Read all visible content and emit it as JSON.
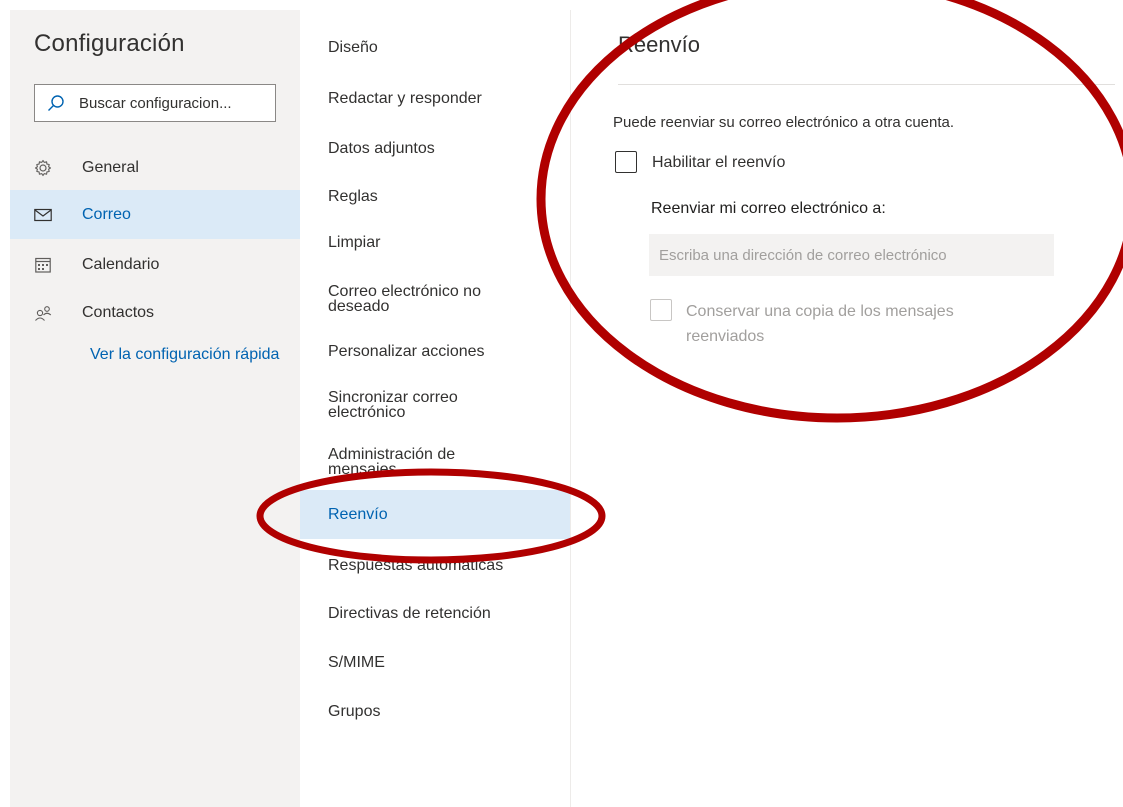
{
  "settings": {
    "title": "Configuración",
    "search_placeholder": "Buscar configuracion..."
  },
  "nav": {
    "items": [
      {
        "label": "General",
        "icon": "gear-icon",
        "selected": false
      },
      {
        "label": "Correo",
        "icon": "mail-icon",
        "selected": true
      },
      {
        "label": "Calendario",
        "icon": "calendar-icon",
        "selected": false
      },
      {
        "label": "Contactos",
        "icon": "people-icon",
        "selected": false
      }
    ],
    "quick_link": "Ver la configuración rápida"
  },
  "categories": {
    "items": [
      "Diseño",
      "Redactar y responder",
      "Datos adjuntos",
      "Reglas",
      "Limpiar",
      "Correo electrónico no deseado",
      "Personalizar acciones",
      "Sincronizar correo electrónico",
      "Administración de mensajes",
      "Reenvío",
      "Respuestas automáticas",
      "Directivas de retención",
      "S/MIME",
      "Grupos"
    ],
    "selected": "Reenvío"
  },
  "detail": {
    "title": "Reenvío",
    "description": "Puede reenviar su correo electrónico a otra cuenta.",
    "enable_label": "Habilitar el reenvío",
    "enable_checked": false,
    "forward_heading": "Reenviar mi correo electrónico a:",
    "address_placeholder": "Escriba una dirección de correo electrónico",
    "address_value": "",
    "keep_copy_label": "Conservar una copia de los mensajes reenviados",
    "keep_copy_checked": false,
    "keep_copy_disabled": true
  },
  "colors": {
    "accent": "#0063b1",
    "selected_bg": "#dbeaf7",
    "pane_bg": "#f3f2f1",
    "annotation": "#b00000"
  }
}
